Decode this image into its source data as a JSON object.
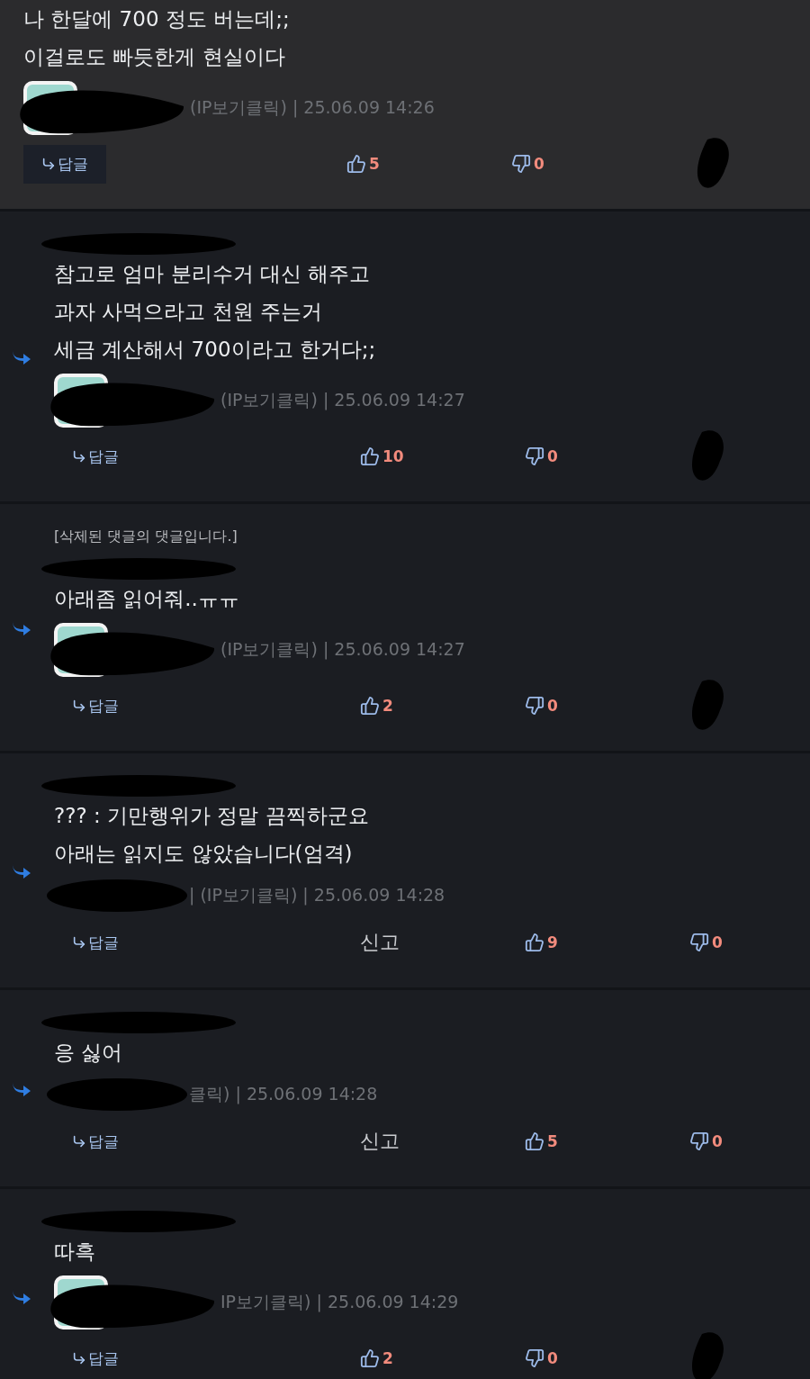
{
  "comments": [
    {
      "reply": false,
      "highlighted": true,
      "avatar": true,
      "scribble": true,
      "lines": [
        "나 한달에 700 정도 버는데;;",
        "이걸로도 빠듯한게 현실이다"
      ],
      "meta": "(IP보기클릭) | 25.06.09 14:26",
      "reply_label": "답글",
      "likes": "5",
      "dislikes": "0"
    },
    {
      "reply": true,
      "highlighted": false,
      "avatar": true,
      "scribble": true,
      "lines": [
        "참고로 엄마 분리수거 대신 해주고",
        "과자 사먹으라고 천원 주는거",
        "세금 계산해서 700이라고 한거다;;"
      ],
      "meta": "(IP보기클릭) | 25.06.09 14:27",
      "reply_label": "답글",
      "likes": "10",
      "dislikes": "0"
    },
    {
      "reply": true,
      "highlighted": false,
      "avatar": true,
      "scribble": true,
      "note": "[삭제된 댓글의 댓글입니다.]",
      "lines": [
        "아래좀 읽어줘..ㅠㅠ"
      ],
      "meta": "(IP보기클릭) | 25.06.09 14:27",
      "reply_label": "답글",
      "likes": "2",
      "dislikes": "0"
    },
    {
      "reply": true,
      "highlighted": false,
      "avatar": false,
      "scribble": false,
      "lines": [
        "??? : 기만행위가 정말 끔찍하군요",
        "아래는 읽지도 않았습니다(엄격)"
      ],
      "meta": "| (IP보기클릭) | 25.06.09 14:28",
      "reply_label": "답글",
      "report": "신고",
      "likes": "9",
      "dislikes": "0"
    },
    {
      "reply": true,
      "highlighted": false,
      "avatar": false,
      "scribble": false,
      "lines": [
        "응 싫어"
      ],
      "meta": "클릭) | 25.06.09 14:28",
      "reply_label": "답글",
      "report": "신고",
      "likes": "5",
      "dislikes": "0"
    },
    {
      "reply": true,
      "highlighted": false,
      "avatar": true,
      "scribble": true,
      "lines": [
        "따흑"
      ],
      "meta": "IP보기클릭) | 25.06.09 14:29",
      "reply_label": "답글",
      "likes": "2",
      "dislikes": "0"
    }
  ]
}
